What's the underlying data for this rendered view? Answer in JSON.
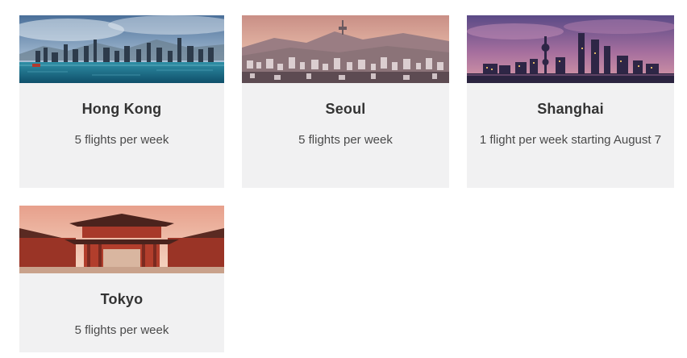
{
  "destinations": [
    {
      "city": "Hong Kong",
      "frequency": "5 flights per week",
      "photo_icon": "hong-kong-skyline-photo"
    },
    {
      "city": "Seoul",
      "frequency": "5 flights per week",
      "photo_icon": "seoul-cityscape-photo"
    },
    {
      "city": "Shanghai",
      "frequency": "1 flight per week starting August 7",
      "photo_icon": "shanghai-skyline-photo"
    },
    {
      "city": "Tokyo",
      "frequency": "5 flights per week",
      "photo_icon": "tokyo-temple-photo"
    }
  ],
  "colors": {
    "card_background": "#f1f1f2",
    "title_text": "#333333",
    "body_text": "#4a4a4a"
  }
}
